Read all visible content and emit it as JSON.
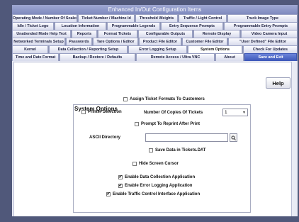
{
  "window": {
    "title": "Enhanced In/Out Configuration Items"
  },
  "tab_rows": [
    [
      "Operating Mode / Number Of Scales",
      "Ticket Number / Machine Id",
      "Threshold Weights",
      "Traffic / Light Control",
      "Truck Image Type"
    ],
    [
      "Idle / Ticket Logo",
      "Location Information",
      "Programmable Legends",
      "Entry Sequence Prompts",
      "Programmable Entry Prompts"
    ],
    [
      "Unattended Mode Help Text",
      "Reports",
      "Format Tickets",
      "Configurable Outputs",
      "Remote Display",
      "Video Camera Input"
    ],
    [
      "Networked Terminals Setup",
      "Passwords",
      "Tare Options / Editor",
      "Product File Editor",
      "Customer File Editor",
      "\"User Defined\" File Editor"
    ],
    [
      "Kernel",
      "Data Collection / Reporting Setup",
      "Error Logging Setup",
      "System Options",
      "Check For Updates"
    ],
    [
      "Time and Date Format",
      "Backup / Restore / Defaults",
      "Remote Access / Ultra VNC",
      "About",
      "Save and Exit"
    ]
  ],
  "system_options": {
    "help_label": "Help",
    "group_title": "System Options",
    "assign_formats_label": "Assign Ticket Formats To Customers",
    "printer_selection_label": "Printer Selection",
    "copies_label": "Number Of Copies Of Tickets",
    "copies_value": "1",
    "reprint_label": "Prompt To Reprint After Print",
    "ascii_directory_label": "ASCII Directory",
    "ascii_directory_value": "",
    "save_tickets_label": "Save Data in Tickets.DAT",
    "hide_cursor_label": "Hide Screen Cursor",
    "enable_data_collection_label": "Enable Data Collection Application",
    "enable_error_logging_label": "Enable Error Logging Application",
    "enable_traffic_control_label": "Enable Traffic Control Interface Application",
    "check_mark": "✔"
  },
  "colors": {
    "background": "#50587a",
    "title_bar": "#8c96c8",
    "save_exit_tab": "#4a63c4"
  }
}
